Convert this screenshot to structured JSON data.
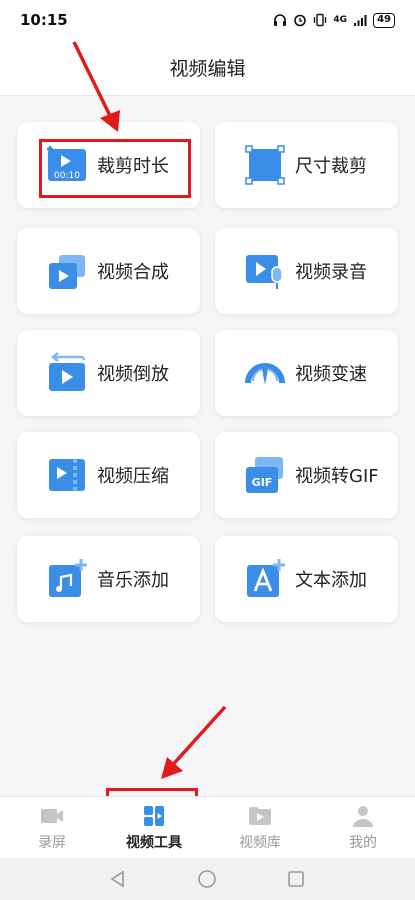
{
  "status_bar": {
    "time": "10:15",
    "battery": "49",
    "network": "4G"
  },
  "header": {
    "title": "视频编辑"
  },
  "tools": [
    {
      "label": "裁剪时长",
      "icon": "trim-duration-icon",
      "badge": "00:10"
    },
    {
      "label": "尺寸裁剪",
      "icon": "crop-size-icon"
    },
    {
      "label": "视频合成",
      "icon": "video-merge-icon"
    },
    {
      "label": "视频录音",
      "icon": "video-record-audio-icon"
    },
    {
      "label": "视频倒放",
      "icon": "video-reverse-icon"
    },
    {
      "label": "视频变速",
      "icon": "video-speed-icon"
    },
    {
      "label": "视频压缩",
      "icon": "video-compress-icon"
    },
    {
      "label": "视频转GIF",
      "icon": "video-to-gif-icon",
      "badge": "GIF"
    },
    {
      "label": "音乐添加",
      "icon": "add-music-icon"
    },
    {
      "label": "文本添加",
      "icon": "add-text-icon"
    }
  ],
  "bottom_nav": [
    {
      "label": "录屏",
      "icon": "screen-record-icon",
      "active": false
    },
    {
      "label": "视频工具",
      "icon": "video-tools-icon",
      "active": true
    },
    {
      "label": "视频库",
      "icon": "video-library-icon",
      "active": false
    },
    {
      "label": "我的",
      "icon": "profile-icon",
      "active": false
    }
  ],
  "colors": {
    "accent": "#3a8ee8",
    "accent_light": "#7db8f5",
    "annotation_red": "#e11b1b",
    "inactive": "#c5c5c5"
  }
}
